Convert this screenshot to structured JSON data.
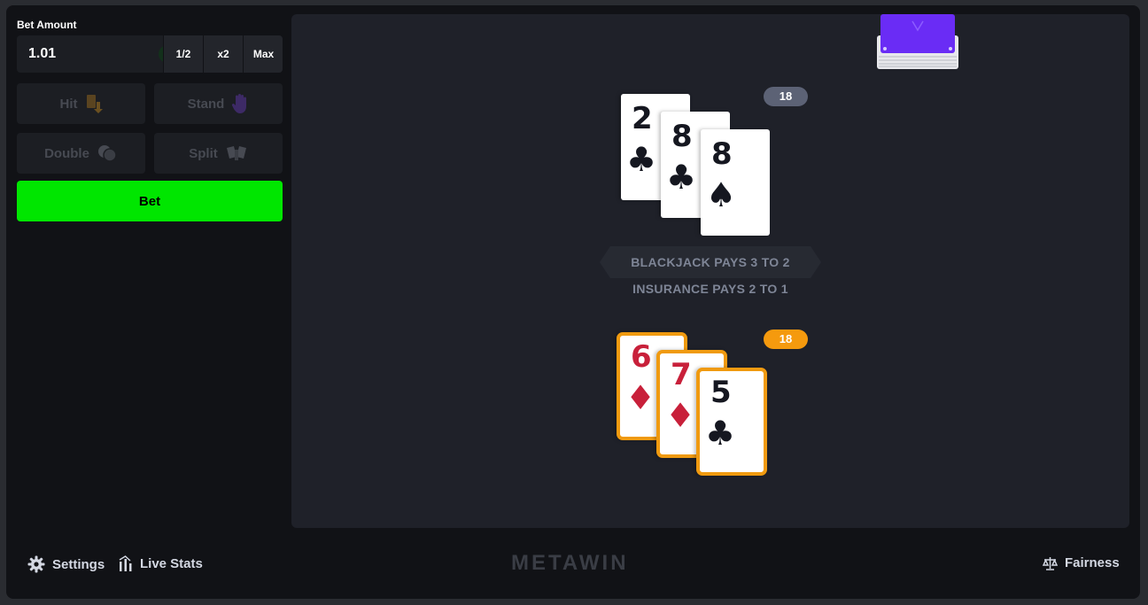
{
  "bet": {
    "label": "Bet Amount",
    "amount": "1.01",
    "currency_symbol": "$",
    "half_label": "1/2",
    "double_label": "x2",
    "max_label": "Max"
  },
  "actions": {
    "hit": "Hit",
    "stand": "Stand",
    "double": "Double",
    "split": "Split",
    "bet": "Bet"
  },
  "dealer": {
    "score": "18",
    "cards": [
      {
        "rank": "2",
        "suit": "♣",
        "color": "black"
      },
      {
        "rank": "8",
        "suit": "♣",
        "color": "black"
      },
      {
        "rank": "8",
        "suit": "♠",
        "color": "black"
      }
    ]
  },
  "player": {
    "score": "18",
    "cards": [
      {
        "rank": "6",
        "suit": "♦",
        "color": "red"
      },
      {
        "rank": "7",
        "suit": "♦",
        "color": "red"
      },
      {
        "rank": "5",
        "suit": "♣",
        "color": "black"
      }
    ]
  },
  "rules": {
    "line1": "BLACKJACK PAYS 3 TO 2",
    "line2": "INSURANCE PAYS 2 TO 1"
  },
  "footer": {
    "settings": "Settings",
    "live_stats": "Live Stats",
    "logo": "METAWIN",
    "fairness": "Fairness"
  },
  "colors": {
    "bet_button": "#00e600",
    "player_highlight": "#f59a0e",
    "dealer_badge": "#5c6275",
    "deck_back": "#6a2cf5"
  }
}
